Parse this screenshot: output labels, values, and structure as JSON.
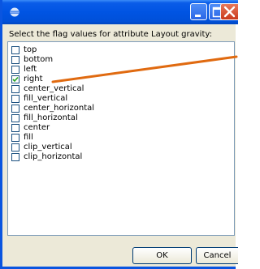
{
  "dialog": {
    "prompt": "Select the flag values for attribute Layout gravity:",
    "items": [
      {
        "label": "top",
        "checked": false
      },
      {
        "label": "bottom",
        "checked": false
      },
      {
        "label": "left",
        "checked": false
      },
      {
        "label": "right",
        "checked": true
      },
      {
        "label": "center_vertical",
        "checked": false
      },
      {
        "label": "fill_vertical",
        "checked": false
      },
      {
        "label": "center_horizontal",
        "checked": false
      },
      {
        "label": "fill_horizontal",
        "checked": false
      },
      {
        "label": "center",
        "checked": false
      },
      {
        "label": "fill",
        "checked": false
      },
      {
        "label": "clip_vertical",
        "checked": false
      },
      {
        "label": "clip_horizontal",
        "checked": false
      }
    ],
    "ok_label": "OK",
    "cancel_label": "Cancel"
  },
  "icons": {
    "app": "eclipse-icon",
    "minimize": "minimize-icon",
    "maximize": "maximize-icon",
    "close": "close-icon"
  },
  "colors": {
    "titlebar": "#0054e3",
    "close_button": "#c9391b",
    "annotation_arrow": "#e06a10",
    "checkmark": "#21a121"
  }
}
